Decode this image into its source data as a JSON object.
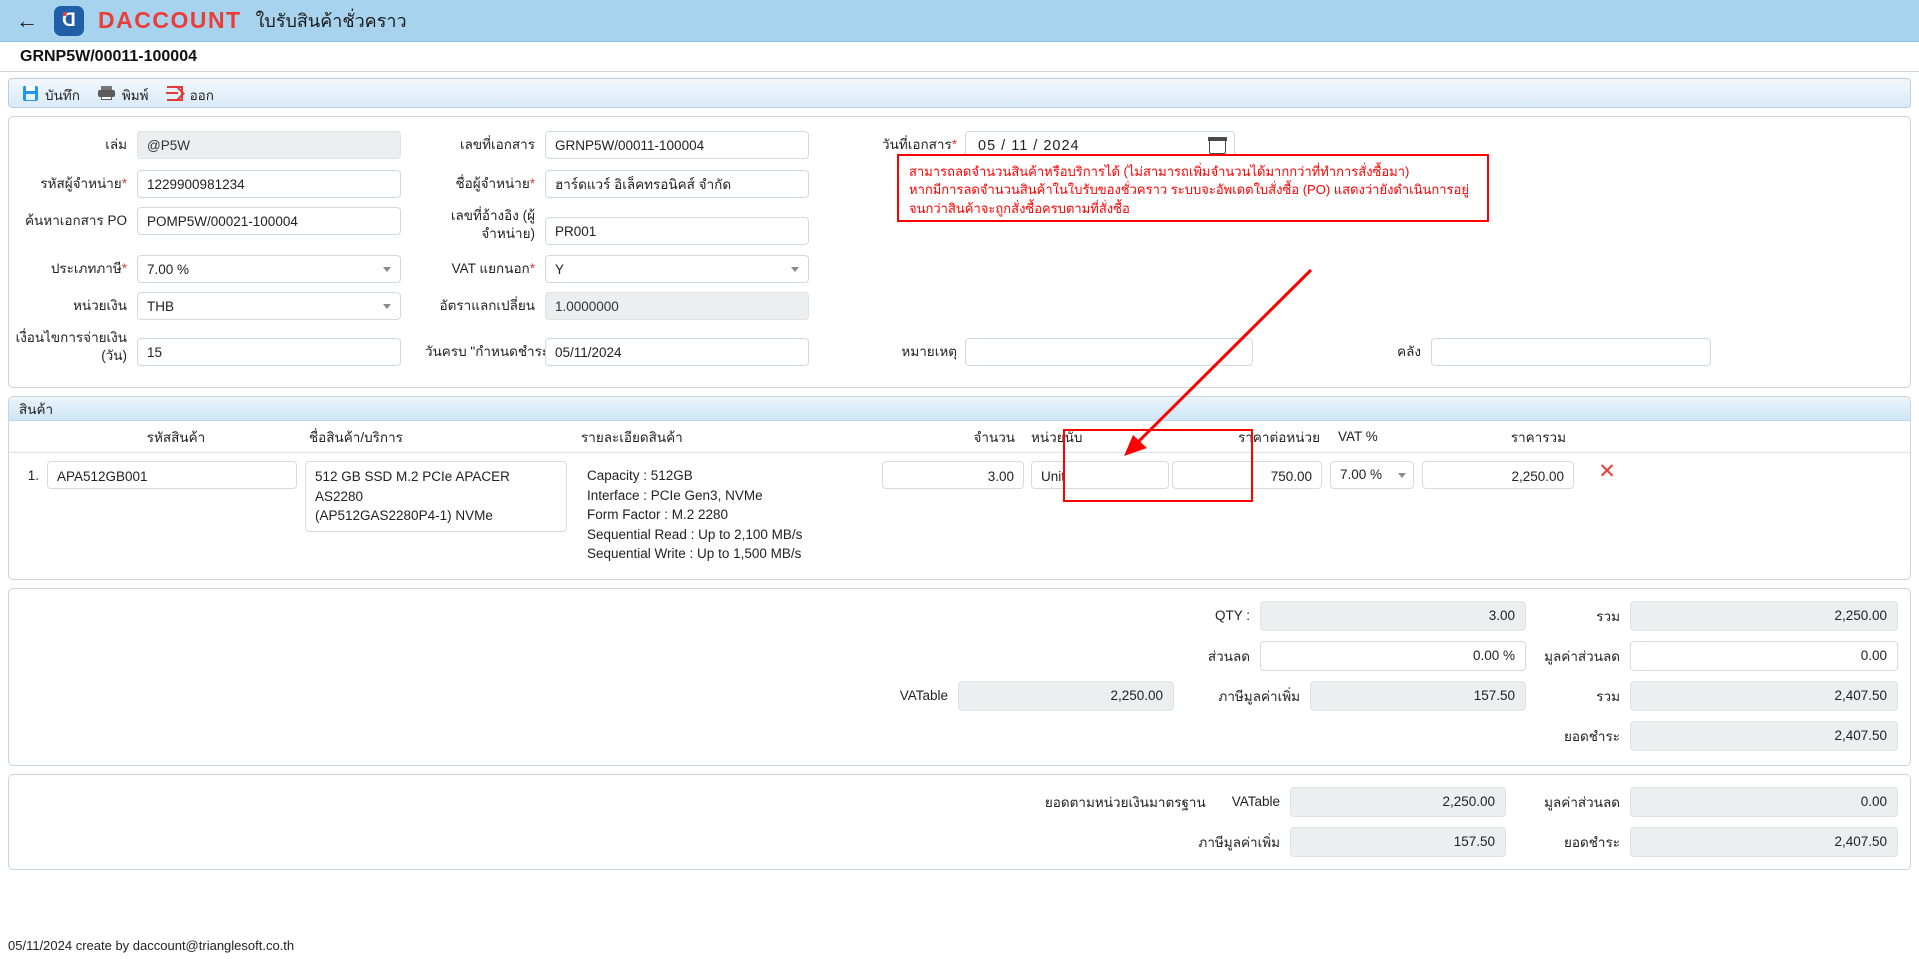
{
  "appbar": {
    "back_icon": "back-arrow-icon",
    "logo_icon": "daccount-logo-icon",
    "brand": "DACCOUNT",
    "title": "ใบรับสินค้าชั่วคราว"
  },
  "docbar": {
    "document_number": "GRNP5W/00011-100004"
  },
  "toolbar": {
    "save_label": "บันทึก",
    "print_label": "พิมพ์",
    "exit_label": "ออก"
  },
  "form": {
    "book": {
      "label": "เล่ม",
      "value": "@P5W"
    },
    "vendor_code": {
      "label": "รหัสผู้จำหน่าย",
      "required": "*",
      "value": "1229900981234"
    },
    "search_po": {
      "label": "ค้นหาเอกสาร PO",
      "value": "POMP5W/00021-100004"
    },
    "tax_type": {
      "label": "ประเภทภาษี",
      "required": "*",
      "value": "7.00 %"
    },
    "currency": {
      "label": "หน่วยเงิน",
      "value": "THB"
    },
    "payment_terms": {
      "label": "เงื่อนไขการจ่ายเงิน (วัน)",
      "label_l1": "เงื่อนไขการจ่ายเงิน",
      "label_l2": "(วัน)",
      "value": "15"
    },
    "doc_number": {
      "label": "เลขที่เอกสาร",
      "value": "GRNP5W/00011-100004"
    },
    "vendor_name": {
      "label": "ชื่อผู้จำหน่าย",
      "required": "*",
      "value": "ฮาร์ดแวร์ อิเล็คทรอนิคส์ จำกัด"
    },
    "reference_no": {
      "label": "เลขที่อ้างอิง (ผู้จำหน่าย)",
      "label_l1": "เลขที่อ้างอิง (ผู้",
      "label_l2": "จำหน่าย)",
      "value": "PR001"
    },
    "vat_separate": {
      "label": "VAT แยกนอก",
      "required": "*",
      "value": "Y"
    },
    "exchange_rate": {
      "label": "อัตราแลกเปลี่ยน",
      "value": "1.0000000"
    },
    "due_date": {
      "label": "วันครบ \"กำหนดชำระ\"",
      "value": "05/11/2024"
    },
    "doc_date": {
      "label": "วันที่เอกสาร",
      "required": "*",
      "value": "05 / 11 / 2024",
      "calendar_icon": "calendar-icon"
    },
    "remark": {
      "label": "หมายเหตุ",
      "value": ""
    },
    "warehouse": {
      "label": "คลัง",
      "value": ""
    }
  },
  "note_box": {
    "lines": [
      "สามารถลดจำนวนสินค้าหรือบริการได้ (ไม่สามารถเพิ่มจำนวนได้มากกว่าที่ทำการสั่งซื้อมา)",
      "หากมีการลดจำนวนสินค้าในใบรับของชั่วคราว ระบบจะอัพเดตใบสั่งซื้อ (PO) แสดงว่ายังดำเนินการอยู่",
      "จนกว่าสินค้าจะถูกสั่งซื้อครบตามที่สั่งซื้อ"
    ],
    "color": "#ff0000"
  },
  "items": {
    "section_title": "สินค้า",
    "headers": {
      "code": "รหัสสินค้า",
      "name": "ชื่อสินค้า/บริการ",
      "description": "รายละเอียดสินค้า",
      "qty": "จำนวน",
      "unit": "หน่วยนับ",
      "unit_price": "ราคาต่อหน่วย",
      "vat_pct": "VAT %",
      "total": "ราคารวม"
    },
    "rows": [
      {
        "index": "1.",
        "code": "APA512GB001",
        "name_l1": "512 GB SSD M.2 PCIe APACER AS2280",
        "name_l2": "(AP512GAS2280P4-1) NVMe",
        "description": [
          "Capacity : 512GB",
          "Interface : PCIe Gen3, NVMe",
          "Form Factor : M.2 2280",
          "Sequential Read : Up to 2,100 MB/s",
          "Sequential Write : Up to 1,500 MB/s"
        ],
        "qty": "3.00",
        "unit": "Unit",
        "unit_price": "750.00",
        "vat_pct": "7.00 %",
        "total": "2,250.00",
        "delete_icon": "delete-row-icon"
      }
    ]
  },
  "summary": {
    "qty_label": "QTY :",
    "qty_value": "3.00",
    "total_label": "รวม",
    "total_value": "2,250.00",
    "discount_label": "ส่วนลด",
    "discount_value": "0.00 %",
    "discount_amt_label": "มูลค่าส่วนลด",
    "discount_amt_value": "0.00",
    "vatable_label": "VATable",
    "vatable_value": "2,250.00",
    "vat_label": "ภาษีมูลค่าเพิ่ม",
    "vat_value": "157.50",
    "grand_label": "รวม",
    "grand_value": "2,407.50",
    "payable_label": "ยอดชำระ",
    "payable_value": "2,407.50"
  },
  "standard_summary": {
    "title": "ยอดตามหน่วยเงินมาตรฐาน",
    "vatable_label": "VATable",
    "vatable_value": "2,250.00",
    "discount_amt_label": "มูลค่าส่วนลด",
    "discount_amt_value": "0.00",
    "vat_label": "ภาษีมูลค่าเพิ่ม",
    "vat_value": "157.50",
    "payable_label": "ยอดชำระ",
    "payable_value": "2,407.50"
  },
  "footer": {
    "text": "05/11/2024 create by daccount@trianglesoft.co.th"
  }
}
